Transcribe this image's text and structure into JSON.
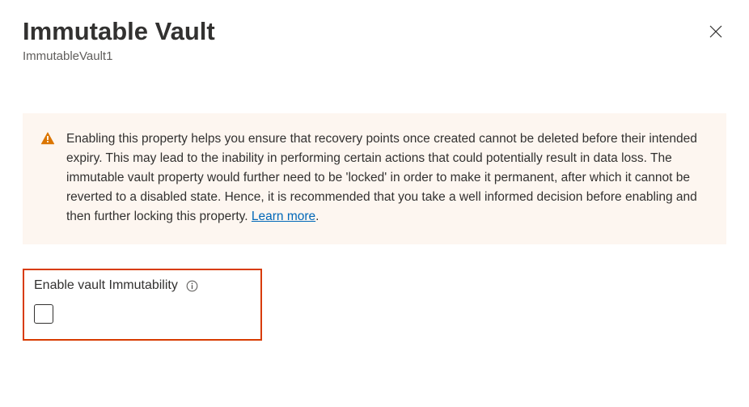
{
  "header": {
    "title": "Immutable Vault",
    "subtitle": "ImmutableVault1"
  },
  "warning": {
    "text": "Enabling this property helps you ensure that recovery points once created cannot be deleted before their intended expiry. This may lead to the inability in performing certain actions that could potentially result in data loss. The immutable vault property would further need to be 'locked' in order to make it permanent, after which it cannot be reverted to a disabled state. Hence, it is recommended that you take a well informed decision before enabling and then further locking this property. ",
    "learnMore": "Learn more"
  },
  "control": {
    "label": "Enable vault Immutability",
    "checked": false
  }
}
